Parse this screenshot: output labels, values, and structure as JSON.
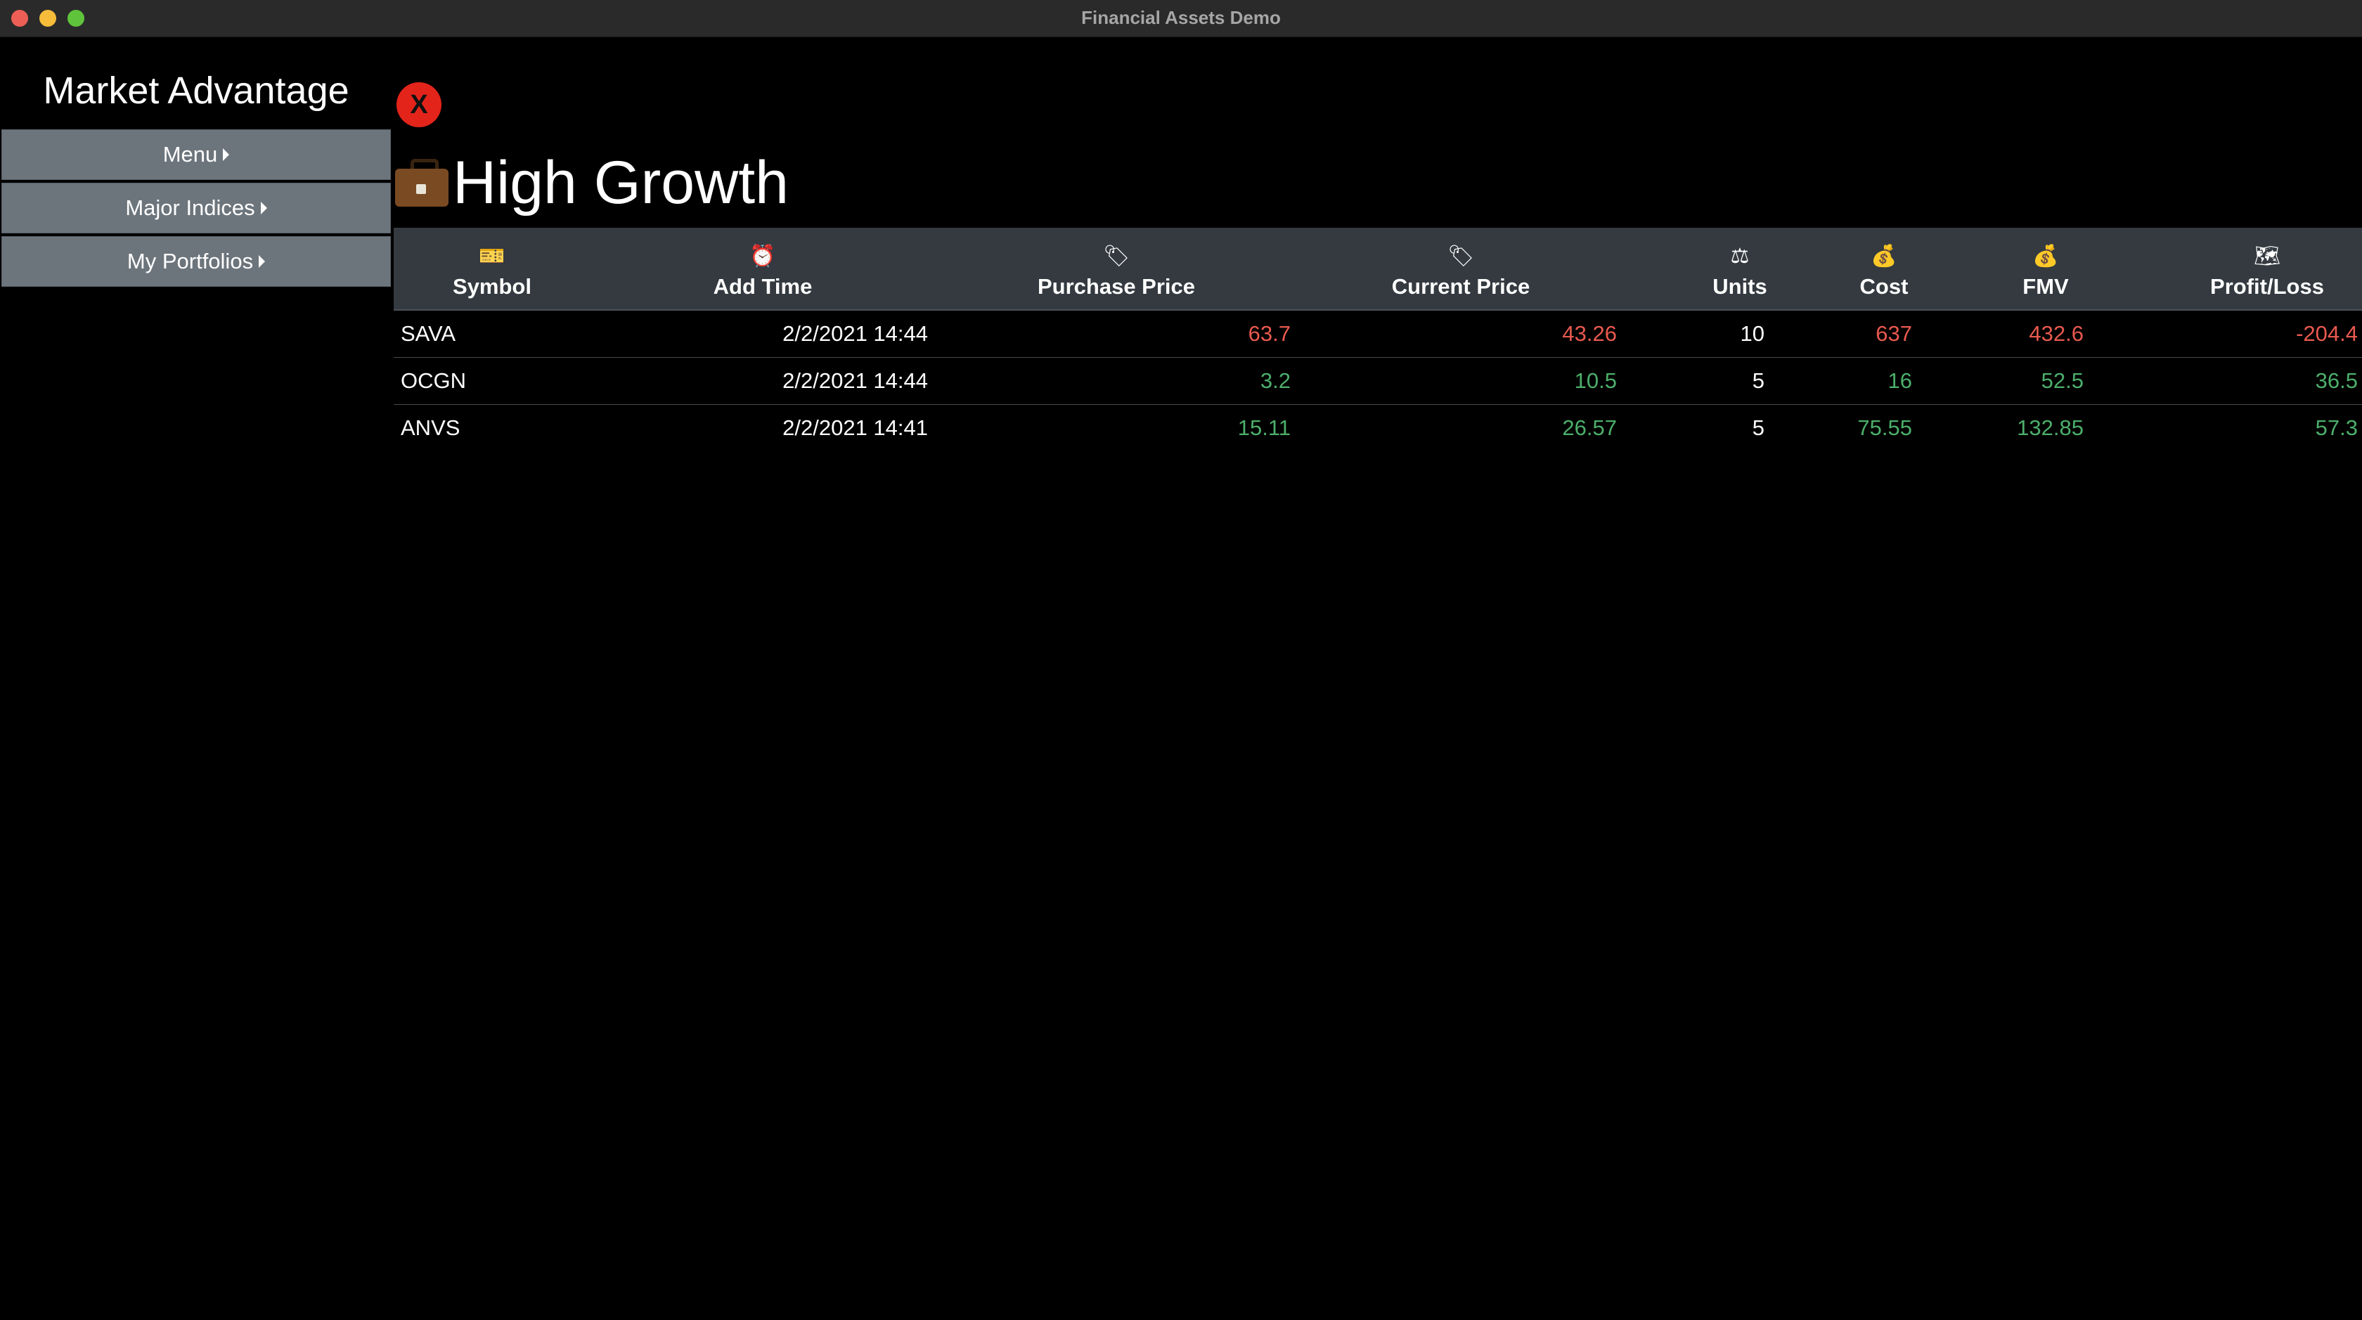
{
  "window": {
    "title": "Financial Assets Demo"
  },
  "sidebar": {
    "brand": "Market Advantage",
    "items": [
      {
        "label": "Menu"
      },
      {
        "label": "Major Indices"
      },
      {
        "label": "My Portfolios"
      }
    ]
  },
  "close_button": {
    "label": "X"
  },
  "portfolio": {
    "title": "High Growth",
    "icon": "briefcase-icon"
  },
  "table": {
    "columns": [
      {
        "label": "Symbol",
        "icon": "🎫"
      },
      {
        "label": "Add Time",
        "icon": "⏰"
      },
      {
        "label": "Purchase Price",
        "icon": "🏷"
      },
      {
        "label": "Current Price",
        "icon": "🏷"
      },
      {
        "label": "Units",
        "icon": "⚖"
      },
      {
        "label": "Cost",
        "icon": "💰"
      },
      {
        "label": "FMV",
        "icon": "💰"
      },
      {
        "label": "Profit/Loss",
        "icon": "🗺"
      }
    ],
    "rows": [
      {
        "symbol": "SAVA",
        "add_time": "2/2/2021 14:44",
        "purchase_price": "63.7",
        "current_price": "43.26",
        "units": "10",
        "cost": "637",
        "fmv": "432.6",
        "profit_loss": "-204.4",
        "trend": "loss"
      },
      {
        "symbol": "OCGN",
        "add_time": "2/2/2021 14:44",
        "purchase_price": "3.2",
        "current_price": "10.5",
        "units": "5",
        "cost": "16",
        "fmv": "52.5",
        "profit_loss": "36.5",
        "trend": "gain"
      },
      {
        "symbol": "ANVS",
        "add_time": "2/2/2021 14:41",
        "purchase_price": "15.11",
        "current_price": "26.57",
        "units": "5",
        "cost": "75.55",
        "fmv": "132.85",
        "profit_loss": "57.3",
        "trend": "gain"
      }
    ]
  },
  "colors": {
    "loss": "#e8594f",
    "gain": "#4caf6b",
    "header_bg": "#343a40",
    "nav_bg": "#6d757c"
  }
}
